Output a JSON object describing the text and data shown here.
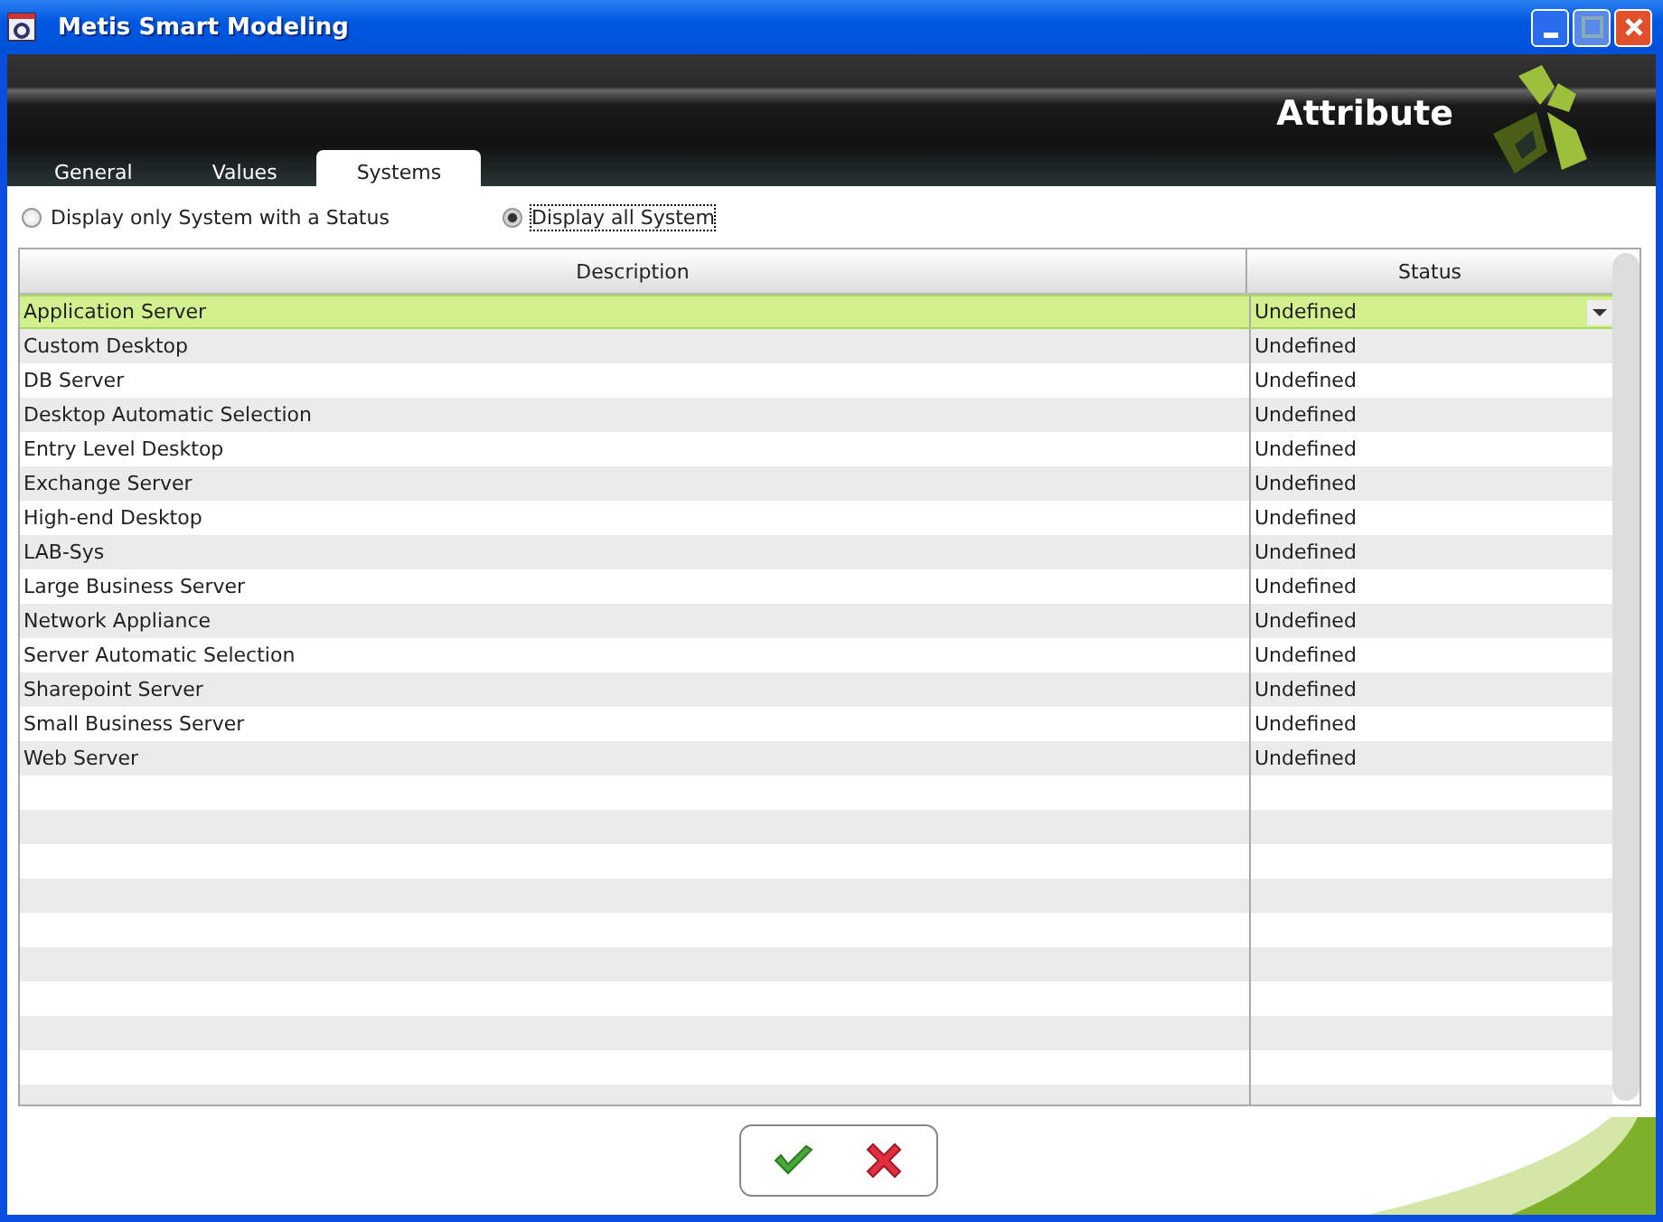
{
  "window": {
    "title": "Metis Smart Modeling"
  },
  "header": {
    "title": "Attribute"
  },
  "tabs": [
    {
      "label": "General",
      "selected": false
    },
    {
      "label": "Values",
      "selected": false
    },
    {
      "label": "Systems",
      "selected": true
    }
  ],
  "filters": [
    {
      "label": "Display only System with a Status",
      "selected": false
    },
    {
      "label": "Display all System",
      "selected": true
    }
  ],
  "table": {
    "columns": [
      "Description",
      "Status"
    ],
    "rows": [
      {
        "description": "Application Server",
        "status": "Undefined",
        "selected": true
      },
      {
        "description": "Custom Desktop",
        "status": "Undefined",
        "selected": false
      },
      {
        "description": "DB Server",
        "status": "Undefined",
        "selected": false
      },
      {
        "description": "Desktop Automatic Selection",
        "status": "Undefined",
        "selected": false
      },
      {
        "description": "Entry Level Desktop",
        "status": "Undefined",
        "selected": false
      },
      {
        "description": "Exchange Server",
        "status": "Undefined",
        "selected": false
      },
      {
        "description": "High-end Desktop",
        "status": "Undefined",
        "selected": false
      },
      {
        "description": "LAB-Sys",
        "status": "Undefined",
        "selected": false
      },
      {
        "description": "Large Business Server",
        "status": "Undefined",
        "selected": false
      },
      {
        "description": "Network Appliance",
        "status": "Undefined",
        "selected": false
      },
      {
        "description": "Server Automatic Selection",
        "status": "Undefined",
        "selected": false
      },
      {
        "description": "Sharepoint Server",
        "status": "Undefined",
        "selected": false
      },
      {
        "description": "Small Business Server",
        "status": "Undefined",
        "selected": false
      },
      {
        "description": "Web Server",
        "status": "Undefined",
        "selected": false
      }
    ]
  }
}
